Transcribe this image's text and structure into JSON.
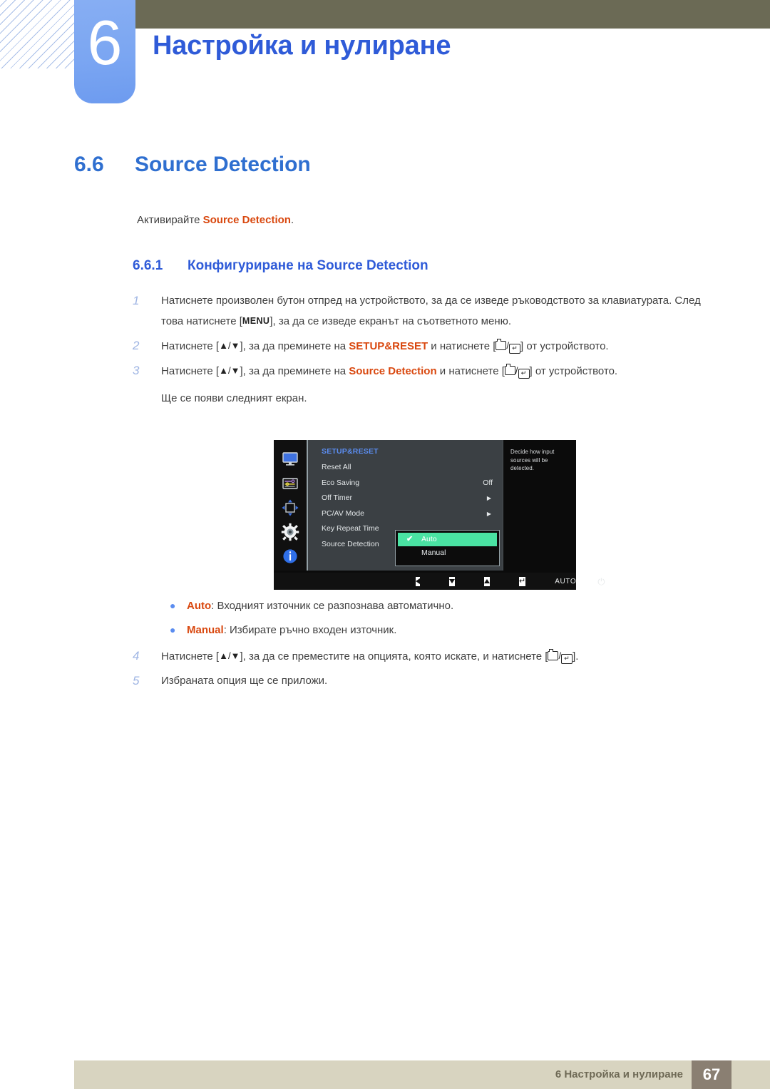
{
  "header": {
    "chapter_number": "6",
    "chapter_title": "Настройка и нулиране",
    "accent_blue": "#2f5bd8",
    "olive": "#6b6a55"
  },
  "section": {
    "number": "6.6",
    "title": "Source Detection",
    "lead_prefix": "Активирайте ",
    "lead_highlight": "Source Detection",
    "lead_suffix": "."
  },
  "subsection": {
    "number": "6.6.1",
    "title": "Конфигуриране на Source Detection"
  },
  "steps": [
    {
      "num": "1",
      "part1": "Натиснете произволен бутон отпред на устройството, за да се изведе ръководството за клавиатурата. След това натиснете [",
      "key": "MENU",
      "part2": "], за да се изведе екранът на съответното меню."
    },
    {
      "num": "2",
      "part1": "Натиснете [",
      "keys": "▲/▼",
      "part2": "], за да преминете на ",
      "highlight": "SETUP&RESET",
      "part3": " и натиснете [",
      "part4": "] от устройството."
    },
    {
      "num": "3",
      "part1": "Натиснете [",
      "keys": "▲/▼",
      "part2": "], за да преминете на ",
      "highlight": "Source Detection",
      "part3": " и натиснете [",
      "part4": "] от устройството.",
      "note": "Ще се появи следният екран."
    }
  ],
  "steps_after": [
    {
      "num": "4",
      "part1": "Натиснете [",
      "keys": "▲/▼",
      "part2": "], за да се преместите на опцията, която искате, и натиснете [",
      "part3": "]."
    },
    {
      "num": "5",
      "part1": "Избраната опция ще се приложи."
    }
  ],
  "osd": {
    "title": "SETUP&RESET",
    "sidebar_icons": [
      "display-icon",
      "picture-settings-icon",
      "screen-adjust-icon",
      "setup-gear-icon",
      "information-icon"
    ],
    "menu_rows": [
      {
        "label": "Reset All",
        "value": "",
        "arrow": false
      },
      {
        "label": "Eco Saving",
        "value": "Off",
        "arrow": false
      },
      {
        "label": "Off Timer",
        "value": "",
        "arrow": true
      },
      {
        "label": "PC/AV Mode",
        "value": "",
        "arrow": true
      },
      {
        "label": "Key Repeat Time",
        "value": "",
        "arrow": false
      },
      {
        "label": "Source Detection",
        "value": "",
        "arrow": false
      }
    ],
    "help_text": "Decide how input sources will be detected.",
    "submenu": [
      {
        "label": "Auto",
        "selected": true
      },
      {
        "label": "Manual",
        "selected": false
      }
    ],
    "buttons": {
      "left": "◀",
      "down": "▼",
      "up": "▲",
      "enter": "↵",
      "auto": "AUTO",
      "power": "⏻"
    },
    "highlight_green": "#4ae3a3",
    "panel_bg": "#3b4044"
  },
  "bullets": [
    {
      "term": "Auto",
      "text": ": Входният източник се разпознава автоматично."
    },
    {
      "term": "Manual",
      "text": ": Избирате ръчно входен източник."
    }
  ],
  "footer": {
    "text": "6 Настройка и нулиране",
    "page": "67"
  }
}
